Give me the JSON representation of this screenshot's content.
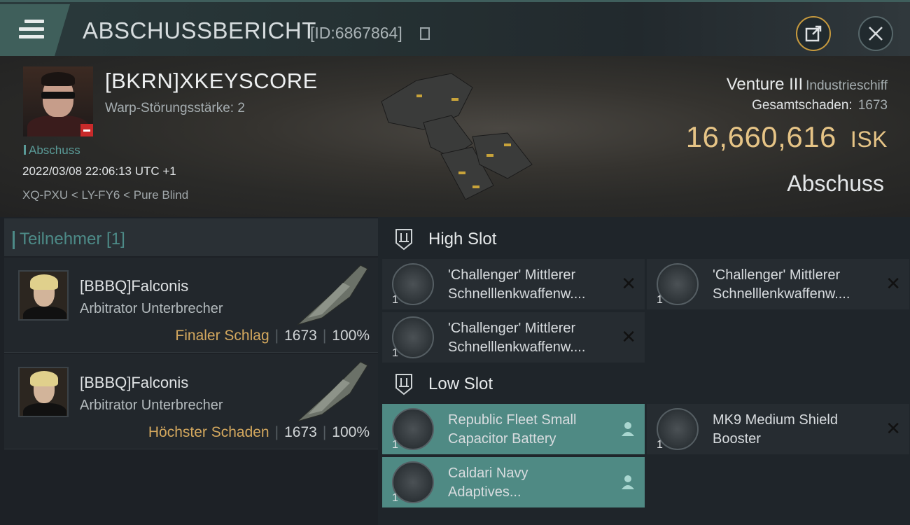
{
  "header": {
    "title": "ABSCHUSSBERICHT",
    "id": "[ID:6867864]"
  },
  "victim": {
    "name": "[BKRN]XKEYSCORE",
    "warp_strength": "Warp-Störungsstärke: 2",
    "loss_label": "Abschuss",
    "datetime": "2022/03/08 22:06:13 UTC +1",
    "location": "XQ-PXU < LY-FY6 < Pure Blind"
  },
  "ship": {
    "name": "Venture III",
    "class": "Industrieschiff",
    "damage_label": "Gesamtschaden:",
    "damage_value": "1673",
    "isk_value": "16,660,616",
    "isk_unit": "ISK",
    "result": "Abschuss"
  },
  "participants": {
    "title": "Teilnehmer [1]",
    "rows": [
      {
        "name": "[BBBQ]Falconis",
        "ship": "Arbitrator Unterbrecher",
        "role": "Finaler Schlag",
        "damage": "1673",
        "percent": "100%"
      },
      {
        "name": "[BBBQ]Falconis",
        "ship": "Arbitrator Unterbrecher",
        "role": "Höchster Schaden",
        "damage": "1673",
        "percent": "100%"
      }
    ]
  },
  "fitting": {
    "high_slot": {
      "title": "High Slot",
      "modules": [
        {
          "qty": "1",
          "line1": "'Challenger' Mittlerer",
          "line2": "Schnelllenkwaffenw...."
        },
        {
          "qty": "1",
          "line1": "'Challenger' Mittlerer",
          "line2": "Schnelllenkwaffenw...."
        },
        {
          "qty": "1",
          "line1": "'Challenger' Mittlerer",
          "line2": "Schnelllenkwaffenw...."
        }
      ]
    },
    "low_slot": {
      "title": "Low Slot",
      "modules": [
        {
          "qty": "1",
          "line1": "Republic Fleet Small",
          "line2": "Capacitor Battery"
        },
        {
          "qty": "1",
          "line1": "MK9 Medium Shield",
          "line2": "Booster"
        },
        {
          "qty": "1",
          "line1": "Caldari Navy",
          "line2": "Adaptives..."
        }
      ]
    }
  },
  "colors": {
    "accent_teal": "#4f8a84",
    "isk_gold": "#e6c486",
    "role_gold": "#d4a85e",
    "loss_red": "#c92a2a"
  }
}
